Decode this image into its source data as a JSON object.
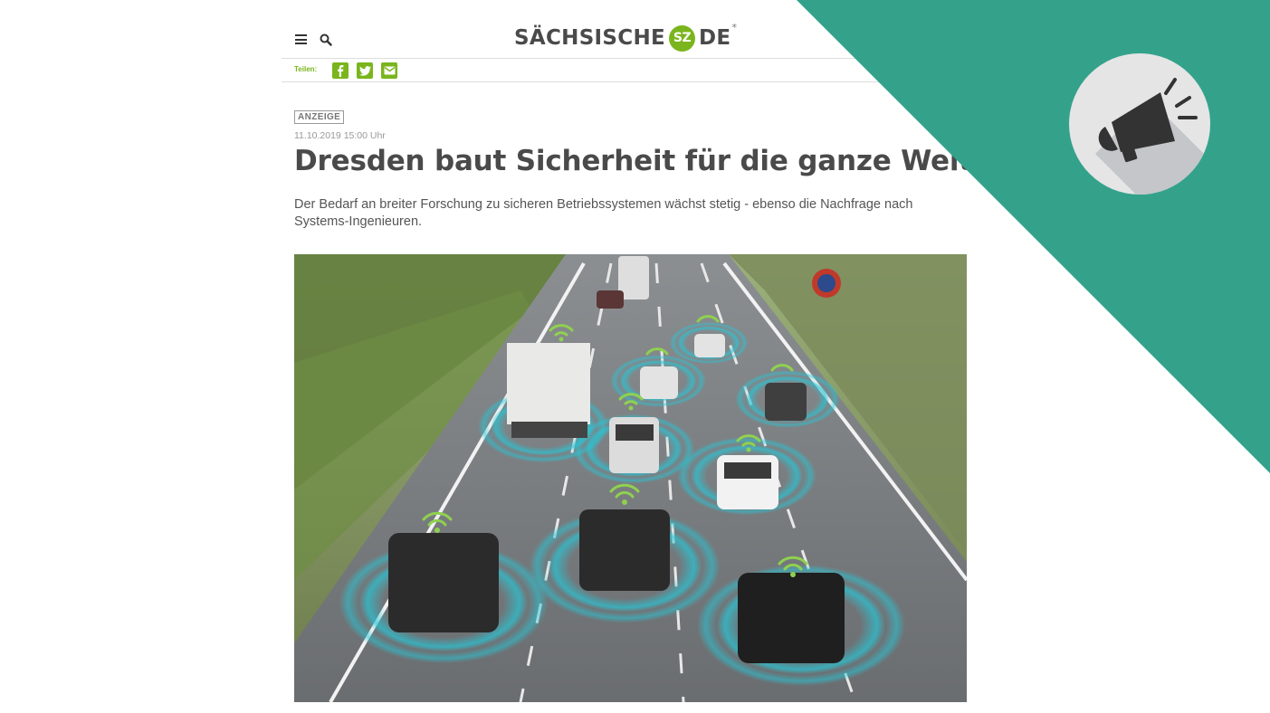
{
  "header": {
    "logo_text_left": "SÄCHSISCHE",
    "logo_badge": "SZ",
    "logo_text_right": "DE",
    "logo_star": "*"
  },
  "share": {
    "label": "Teilen:",
    "buttons": [
      "facebook-icon",
      "twitter-icon",
      "mail-icon"
    ]
  },
  "article": {
    "badge": "ANZEIGE",
    "date": "11.10.2019 15:00 Uhr",
    "title": "Dresden baut Sicherheit für die ganze Welt",
    "lead": "Der Bedarf an breiter Forschung zu sicheren Betriebssystemen wächst stetig - ebenso die Nachfrage nach Systems-Ingenieuren."
  },
  "overlay": {
    "icon": "megaphone-icon",
    "color": "#34a28b"
  },
  "colors": {
    "brand": "#7ab51d",
    "text": "#4a4a4a"
  }
}
